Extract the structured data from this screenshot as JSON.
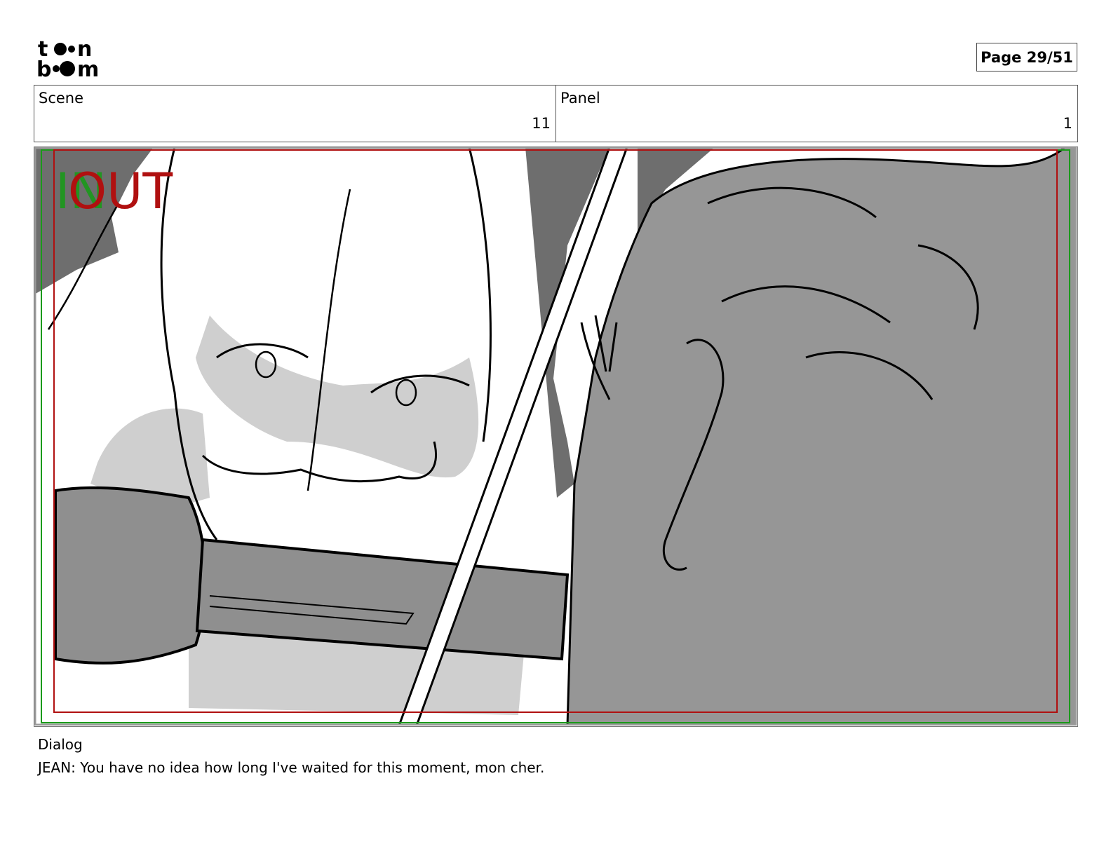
{
  "header": {
    "logo_line1": "toon",
    "logo_line2": "boom",
    "page_label": "Page 29/51"
  },
  "info": {
    "scene_label": "Scene",
    "scene_value": "11",
    "panel_label": "Panel",
    "panel_value": "1"
  },
  "frame": {
    "in_label": "IN",
    "out_label": "OUT",
    "safe_area_color": "#1a9a1a",
    "action_area_color": "#b01010"
  },
  "dialog": {
    "label": "Dialog",
    "text": "JEAN: You have no idea how long I've waited for this moment, mon cher."
  }
}
